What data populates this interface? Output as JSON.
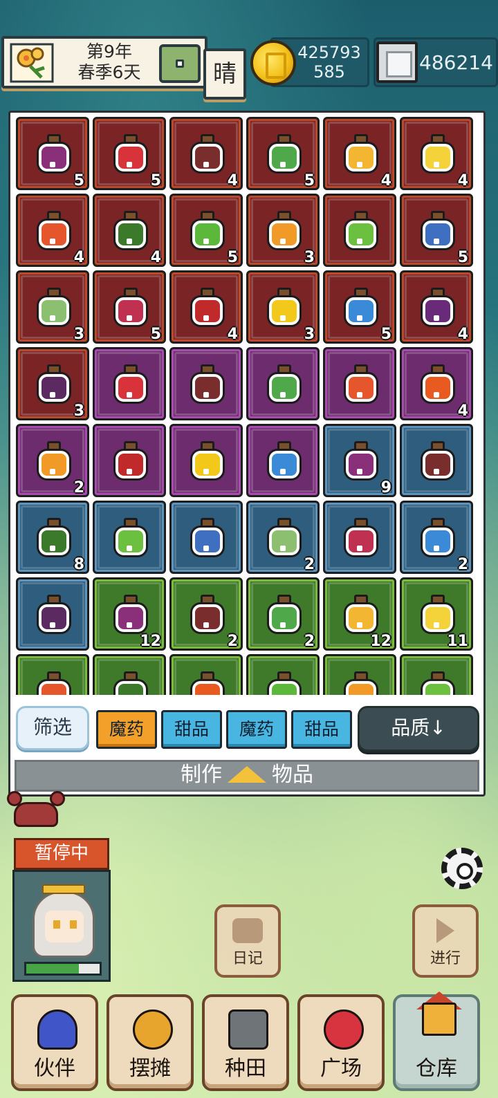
{
  "header": {
    "date_line1": "第9年",
    "date_line2": "春季6天",
    "weather": "晴",
    "gold_line1": "425793",
    "gold_line2": "585",
    "gems": "486214"
  },
  "inventory": {
    "slots": [
      {
        "rarity": "red",
        "color": "#8a2f7a",
        "count": "5"
      },
      {
        "rarity": "red",
        "color": "#d8333a",
        "count": "5"
      },
      {
        "rarity": "red",
        "color": "#7a2d2d",
        "count": "4"
      },
      {
        "rarity": "red",
        "color": "#4fa84a",
        "count": "5"
      },
      {
        "rarity": "red",
        "color": "#f2b632",
        "count": "4"
      },
      {
        "rarity": "red",
        "color": "#f4d33a",
        "count": "4"
      },
      {
        "rarity": "red",
        "color": "#e5562c",
        "count": "4"
      },
      {
        "rarity": "red",
        "color": "#3a7a2a",
        "count": "4"
      },
      {
        "rarity": "red",
        "color": "#5cb83a",
        "count": "5"
      },
      {
        "rarity": "red",
        "color": "#f29a28",
        "count": "3"
      },
      {
        "rarity": "red",
        "color": "#6cc040",
        "count": ""
      },
      {
        "rarity": "red",
        "color": "#3f6fc0",
        "count": "5"
      },
      {
        "rarity": "red",
        "color": "#8cc070",
        "count": "3"
      },
      {
        "rarity": "red",
        "color": "#c03050",
        "count": "5"
      },
      {
        "rarity": "red",
        "color": "#c02a2a",
        "count": "4"
      },
      {
        "rarity": "red",
        "color": "#f2c81a",
        "count": "3"
      },
      {
        "rarity": "red",
        "color": "#3a8ad8",
        "count": "5"
      },
      {
        "rarity": "red",
        "color": "#6a2a7a",
        "count": "4"
      },
      {
        "rarity": "red",
        "color": "#5a2a60",
        "count": "3"
      },
      {
        "rarity": "purple",
        "color": "#d8333a",
        "count": ""
      },
      {
        "rarity": "purple",
        "color": "#7a2d2d",
        "count": ""
      },
      {
        "rarity": "purple",
        "color": "#4fa84a",
        "count": ""
      },
      {
        "rarity": "purple",
        "color": "#e5562c",
        "count": ""
      },
      {
        "rarity": "purple",
        "color": "#e85a20",
        "count": "4"
      },
      {
        "rarity": "purple",
        "color": "#f29a28",
        "count": "2"
      },
      {
        "rarity": "purple",
        "color": "#c02a2a",
        "count": ""
      },
      {
        "rarity": "purple",
        "color": "#f2c81a",
        "count": ""
      },
      {
        "rarity": "purple",
        "color": "#3a8ad8",
        "count": ""
      },
      {
        "rarity": "blue",
        "color": "#8a2f7a",
        "count": "9"
      },
      {
        "rarity": "blue",
        "color": "#7a2d2d",
        "count": ""
      },
      {
        "rarity": "blue",
        "color": "#3a7a2a",
        "count": "8"
      },
      {
        "rarity": "blue",
        "color": "#6cc040",
        "count": ""
      },
      {
        "rarity": "blue",
        "color": "#3f6fc0",
        "count": ""
      },
      {
        "rarity": "blue",
        "color": "#8cc070",
        "count": "2"
      },
      {
        "rarity": "blue",
        "color": "#c03050",
        "count": ""
      },
      {
        "rarity": "blue",
        "color": "#3a8ad8",
        "count": "2"
      },
      {
        "rarity": "blue",
        "color": "#5a2a60",
        "count": ""
      },
      {
        "rarity": "green",
        "color": "#8a2f7a",
        "count": "12"
      },
      {
        "rarity": "green",
        "color": "#7a2d2d",
        "count": "2"
      },
      {
        "rarity": "green",
        "color": "#4fa84a",
        "count": "2"
      },
      {
        "rarity": "green",
        "color": "#f2b632",
        "count": "12"
      },
      {
        "rarity": "green",
        "color": "#f4d33a",
        "count": "11"
      },
      {
        "rarity": "green",
        "color": "#e5562c",
        "count": ""
      },
      {
        "rarity": "green",
        "color": "#3a7a2a",
        "count": ""
      },
      {
        "rarity": "green",
        "color": "#e85a20",
        "count": ""
      },
      {
        "rarity": "green",
        "color": "#5cb83a",
        "count": ""
      },
      {
        "rarity": "green",
        "color": "#f29a28",
        "count": ""
      },
      {
        "rarity": "green",
        "color": "#6cc040",
        "count": ""
      }
    ]
  },
  "filters": {
    "filter_label": "筛选",
    "chips": [
      "魔药",
      "甜品",
      "魔药",
      "甜品"
    ],
    "sort_label": "品质↓",
    "craft_left": "制作",
    "craft_right": "物品"
  },
  "character": {
    "status": "暂停中",
    "hp": 0.72
  },
  "scene": {
    "diary_label": "日记",
    "play_label": "进行"
  },
  "nav": {
    "partners": "伙伴",
    "stall": "摆摊",
    "field": "种田",
    "plaza": "广场",
    "storage": "仓库"
  }
}
